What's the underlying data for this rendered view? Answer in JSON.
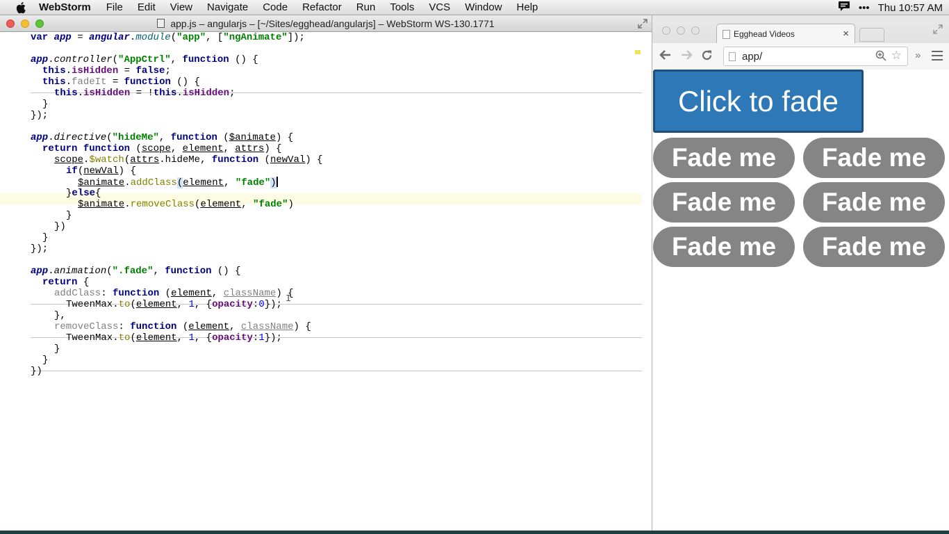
{
  "menubar": {
    "app_name": "WebStorm",
    "items": [
      "File",
      "Edit",
      "View",
      "Navigate",
      "Code",
      "Refactor",
      "Run",
      "Tools",
      "VCS",
      "Window",
      "Help"
    ],
    "clock": "Thu 10:57 AM",
    "status_dots": "•••"
  },
  "ide": {
    "window_title": "app.js – angularjs – [~/Sites/egghead/angularjs] – WebStorm WS-130.1771",
    "code": {
      "l1": {
        "a": "var ",
        "b": "app",
        "c": " = ",
        "d": "angular",
        "e": ".",
        "f": "module",
        "g": "(",
        "h": "\"app\"",
        "i": ", [",
        "j": "\"ngAnimate\"",
        "k": "]);"
      },
      "l3": {
        "a": "app",
        "b": ".",
        "c": "controller",
        "d": "(",
        "e": "\"AppCtrl\"",
        "f": ", ",
        "g": "function",
        "h": " () {"
      },
      "l4": {
        "a": "this",
        "b": ".",
        "c": "isHidden",
        "d": " = ",
        "e": "false",
        "f": ";"
      },
      "l5": {
        "a": "this",
        "b": ".",
        "c": "fadeIt",
        "d": " = ",
        "e": "function",
        "f": " () {"
      },
      "l6": {
        "a": "this",
        "b": ".",
        "c": "isHidden",
        "d": " = !",
        "e": "this",
        "f": ".",
        "g": "isHidden",
        "h": ";"
      },
      "l7": "}",
      "l8": "});",
      "l10": {
        "a": "app",
        "b": ".",
        "c": "directive",
        "d": "(",
        "e": "\"hideMe\"",
        "f": ", ",
        "g": "function",
        "h": " (",
        "i": "$animate",
        "j": ") {"
      },
      "l11": {
        "a": "return ",
        "b": "function",
        "c": " (",
        "d": "scope",
        "e": ", ",
        "f": "element",
        "g": ", ",
        "h": "attrs",
        "i": ") {"
      },
      "l12": {
        "a": "scope",
        "b": ".",
        "c": "$watch",
        "d": "(",
        "e": "attrs",
        "f": ".",
        "g": "hideMe",
        "h": ", ",
        "i": "function",
        "j": " (",
        "k": "newVal",
        "l": ") {"
      },
      "l13": {
        "a": "if",
        "b": "(",
        "c": "newVal",
        "d": ") {"
      },
      "l14": {
        "a": "$animate",
        "b": ".",
        "c": "addClass",
        "d": "(",
        "e": "element",
        "f": ", ",
        "g": "\"fade\"",
        "h": ")"
      },
      "l15": {
        "a": "}",
        "b": "else",
        "c": "{"
      },
      "l16": {
        "a": "$animate",
        "b": ".",
        "c": "removeClass",
        "d": "(",
        "e": "element",
        "f": ", ",
        "g": "\"fade\"",
        "h": ")"
      },
      "l17": "}",
      "l18": "})",
      "l19": "}",
      "l20": "});",
      "l22": {
        "a": "app",
        "b": ".",
        "c": "animation",
        "d": "(",
        "e": "\".fade\"",
        "f": ", ",
        "g": "function",
        "h": " () {"
      },
      "l23": {
        "a": "return ",
        "b": "{"
      },
      "l24": {
        "a": "addClass",
        "b": ": ",
        "c": "function",
        "d": " (",
        "e": "element",
        "f": ", ",
        "g": "className",
        "h": ") {"
      },
      "l25": {
        "a": "TweenMax",
        "b": ".",
        "c": "to",
        "d": "(",
        "e": "element",
        "f": ", ",
        "g": "1",
        "h": ", {",
        "i": "opacity",
        "j": ":",
        "k": "0",
        "l": "});"
      },
      "l26": "},",
      "l27": {
        "a": "removeClass",
        "b": ": ",
        "c": "function",
        "d": " (",
        "e": "element",
        "f": ", ",
        "g": "className",
        "h": ") {"
      },
      "l28": {
        "a": "TweenMax",
        "b": ".",
        "c": "to",
        "d": "(",
        "e": "element",
        "f": ", ",
        "g": "1",
        "h": ", {",
        "i": "opacity",
        "j": ":",
        "k": "1",
        "l": "});"
      },
      "l29": "}",
      "l30": "}",
      "l31": "})"
    }
  },
  "browser": {
    "tab_title": "Egghead Videos",
    "tab_close": "×",
    "url": "app/",
    "overflow": "»",
    "page": {
      "button_label": "Click to fade",
      "fade_items": [
        "Fade me",
        "Fade me",
        "Fade me",
        "Fade me",
        "Fade me",
        "Fade me"
      ]
    }
  },
  "colors": {
    "accent_button": "#2f78b7",
    "pill": "#858585",
    "keyword": "#000080",
    "string": "#008000",
    "property": "#660e7a"
  }
}
